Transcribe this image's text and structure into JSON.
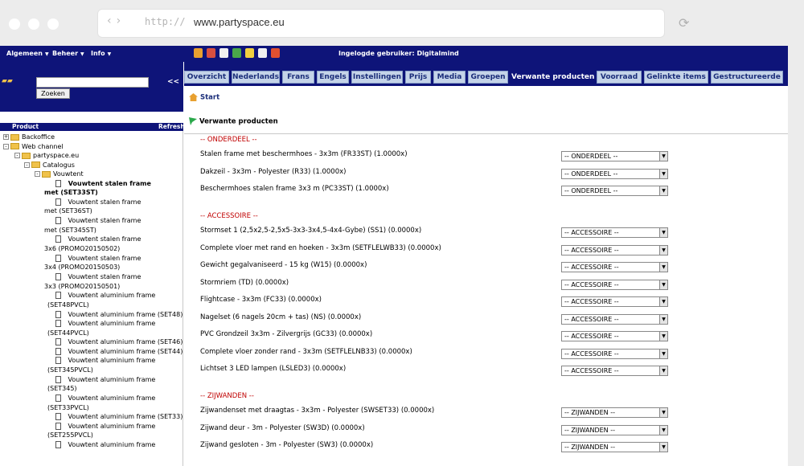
{
  "browser": {
    "url_protocol": "http://",
    "url_host": "www.partyspace.eu"
  },
  "topbar": {
    "menus": [
      "Algemeen",
      "Beheer",
      "Info"
    ],
    "icons": [
      "home-icon",
      "user-icon",
      "document-icon",
      "user-add-icon",
      "inbox-icon",
      "mail-icon",
      "help-icon"
    ],
    "logged_in": "Ingelogde gebruiker: Digitalmind"
  },
  "left": {
    "search_placeholder": "",
    "search_button": "Zoeken",
    "collapse": "<<",
    "tree_title": "Product",
    "refresh": "Refresh",
    "tree": [
      {
        "label": "Backoffice",
        "type": "folder",
        "pm": "+"
      },
      {
        "label": "Web channel",
        "type": "folder",
        "pm": "-"
      },
      {
        "label": "partyspace.eu",
        "type": "folder",
        "pm": "-"
      },
      {
        "label": "Catalogus",
        "type": "folder",
        "pm": "-"
      },
      {
        "label": "Vouwtent",
        "type": "folder",
        "pm": "-"
      },
      {
        "label": "Vouwtent stalen frame",
        "cont": "met (SET33ST)",
        "type": "doc",
        "selected": true
      },
      {
        "label": "Vouwtent stalen frame",
        "cont": "met (SET36ST)",
        "type": "doc"
      },
      {
        "label": "Vouwtent stalen frame",
        "cont": "met (SET345ST)",
        "type": "doc"
      },
      {
        "label": "Vouwtent stalen frame",
        "cont": "3x6 (PROMO20150502)",
        "type": "doc"
      },
      {
        "label": "Vouwtent stalen frame",
        "cont": "3x4 (PROMO20150503)",
        "type": "doc"
      },
      {
        "label": "Vouwtent stalen frame",
        "cont": "3x3 (PROMO20150501)",
        "type": "doc"
      },
      {
        "label": "Vouwtent aluminium frame",
        "cont": "(SET48PVCL)",
        "type": "doc"
      },
      {
        "label": "Vouwtent aluminium frame  (SET48)",
        "type": "doc"
      },
      {
        "label": "Vouwtent aluminium frame",
        "cont": "(SET44PVCL)",
        "type": "doc"
      },
      {
        "label": "Vouwtent aluminium frame  (SET46)",
        "type": "doc"
      },
      {
        "label": "Vouwtent aluminium frame  (SET44)",
        "type": "doc"
      },
      {
        "label": "Vouwtent aluminium frame",
        "cont": "(SET345PVCL)",
        "type": "doc"
      },
      {
        "label": "Vouwtent aluminium frame",
        "cont": "(SET345)",
        "type": "doc"
      },
      {
        "label": "Vouwtent aluminium frame",
        "cont": "(SET33PVCL)",
        "type": "doc"
      },
      {
        "label": "Vouwtent aluminium frame  (SET33)",
        "type": "doc"
      },
      {
        "label": "Vouwtent aluminium frame",
        "cont": "(SET255PVCL)",
        "type": "doc"
      },
      {
        "label": "Vouwtent aluminium frame",
        "type": "doc"
      }
    ]
  },
  "tabs": [
    "Overzicht",
    "Nederlands",
    "Frans",
    "Engels",
    "Instellingen",
    "Prijs",
    "Media",
    "Groepen",
    "Verwante producten",
    "Voorraad",
    "Gelinkte items",
    "Gestructureerde"
  ],
  "active_tab": "Verwante producten",
  "breadcrumb": "Start",
  "section_title": "Verwante producten",
  "groups": [
    {
      "label": "-- ONDERDEEL --",
      "select": "-- ONDERDEEL --",
      "items": [
        "Stalen frame met beschermhoes - 3x3m (FR33ST) (1.0000x)",
        "Dakzeil - 3x3m - Polyester (R33) (1.0000x)",
        "Beschermhoes stalen frame 3x3 m (PC33ST) (1.0000x)"
      ]
    },
    {
      "label": "-- ACCESSOIRE --",
      "select": "-- ACCESSOIRE --",
      "items": [
        "Stormset 1 (2,5x2,5-2,5x5-3x3-3x4,5-4x4-Gybe) (SS1) (0.0000x)",
        "Complete vloer met rand en hoeken - 3x3m (SETFLELWB33) (0.0000x)",
        "Gewicht gegalvaniseerd - 15 kg (W15) (0.0000x)",
        "Stormriem (TD) (0.0000x)",
        "Flightcase - 3x3m (FC33) (0.0000x)",
        "Nagelset (6 nagels 20cm + tas) (NS) (0.0000x)",
        "PVC Grondzeil 3x3m - Zilvergrijs (GC33) (0.0000x)",
        "Complete vloer zonder rand - 3x3m (SETFLELNB33) (0.0000x)",
        "Lichtset 3 LED lampen (LSLED3) (0.0000x)"
      ]
    },
    {
      "label": "-- ZIJWANDEN --",
      "select": "-- ZIJWANDEN --",
      "items": [
        "Zijwandenset met draagtas - 3x3m - Polyester (SWSET33) (0.0000x)",
        "Zijwand deur - 3m - Polyester (SW3D) (0.0000x)",
        "Zijwand gesloten - 3m - Polyester (SW3) (0.0000x)"
      ]
    }
  ]
}
